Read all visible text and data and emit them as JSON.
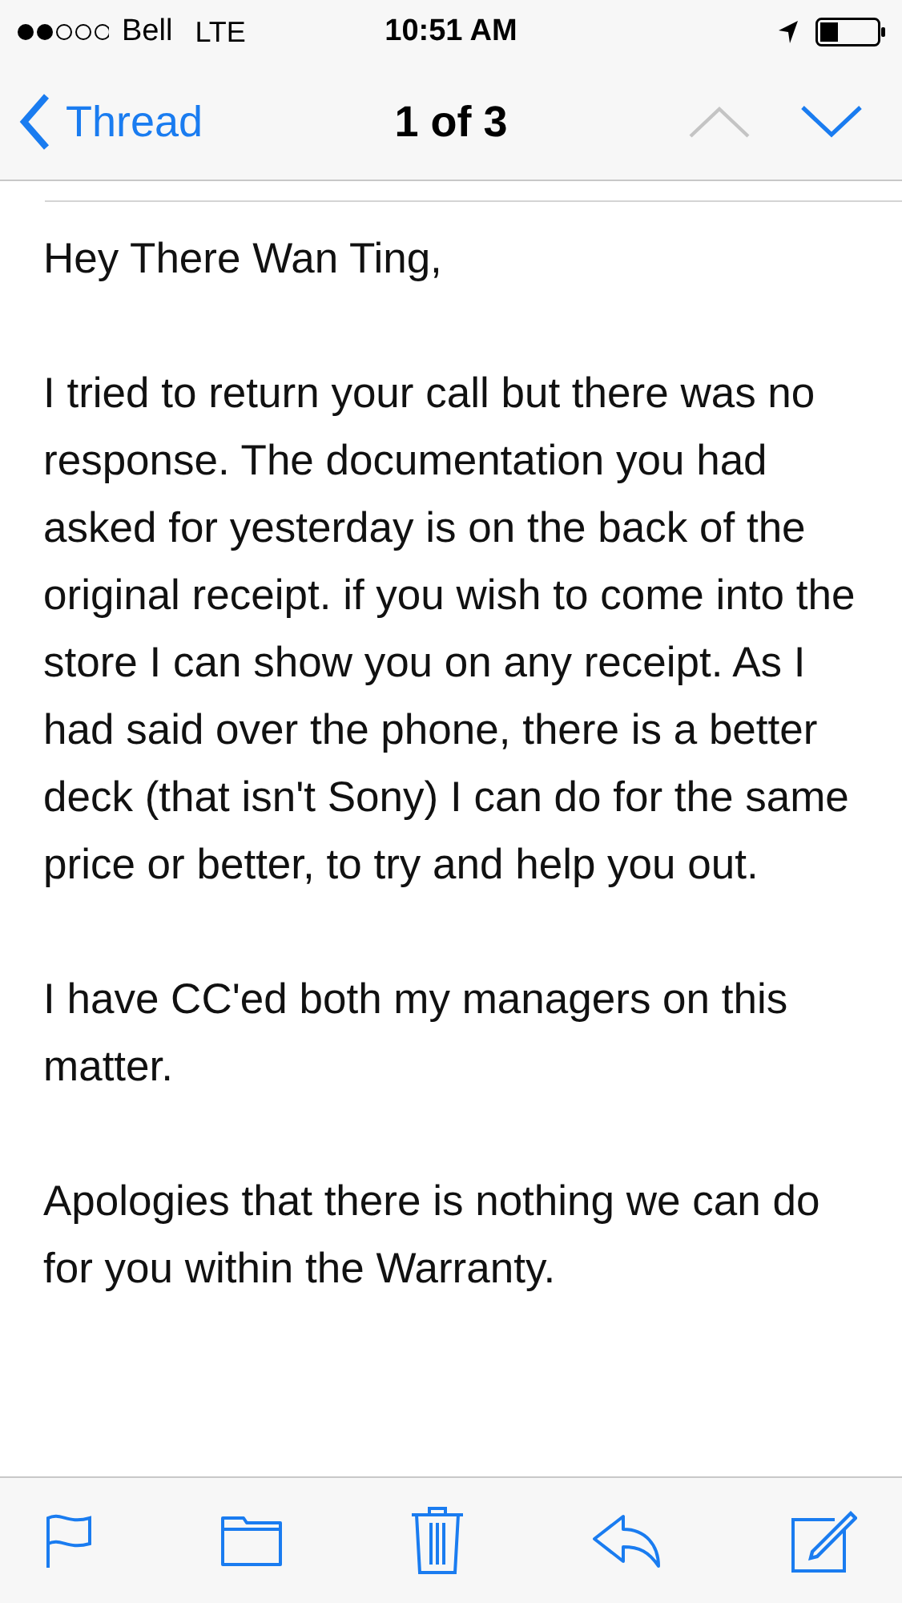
{
  "status_bar": {
    "carrier": "Bell",
    "network": "LTE",
    "time": "10:51 AM"
  },
  "nav_bar": {
    "back_label": "Thread",
    "title": "1 of 3",
    "previous_disabled": true,
    "next_disabled": false
  },
  "message": {
    "paragraphs": [
      "Hey There Wan Ting,",
      "I tried to return your call but there was no response. The documentation you had asked for yesterday is on the back of the original receipt. if you wish to come into the store I can show you on any receipt. As I had said over the phone, there is a better deck (that isn't Sony) I can do for the same price or better, to try and help you out.",
      "I have CC'ed both my managers on this matter.",
      "Apologies that there is nothing we can do for you within the Warranty."
    ]
  }
}
